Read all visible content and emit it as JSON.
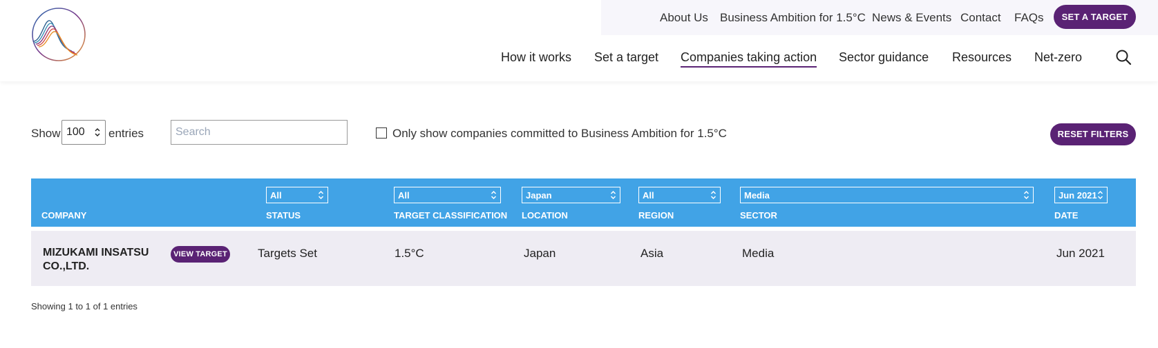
{
  "header": {
    "util_nav": [
      "About Us",
      "Business Ambition for 1.5°C",
      "News & Events",
      "Contact",
      "FAQs"
    ],
    "cta_label": "SET A TARGET",
    "main_nav": [
      "How it works",
      "Set a target",
      "Companies taking action",
      "Sector guidance",
      "Resources",
      "Net-zero"
    ],
    "active_nav": "Companies taking action"
  },
  "controls": {
    "show_label": "Show",
    "entries_value": "100",
    "entries_label": "entries",
    "search_placeholder": "Search",
    "checkbox_label": "Only show companies committed to Business Ambition for 1.5°C",
    "reset_label": "RESET FILTERS"
  },
  "table": {
    "columns": [
      "COMPANY",
      "STATUS",
      "TARGET CLASSIFICATION",
      "LOCATION",
      "REGION",
      "SECTOR",
      "DATE"
    ],
    "filters": {
      "status": "All",
      "target_classification": "All",
      "location": "Japan",
      "region": "All",
      "sector": "Media",
      "date": "Jun 2021"
    },
    "rows": [
      {
        "company": "MIZUKAMI INSATSU CO.,LTD.",
        "action_label": "VIEW TARGET",
        "status": "Targets Set",
        "classification": "1.5°C",
        "location": "Japan",
        "region": "Asia",
        "sector": "Media",
        "date": "Jun 2021"
      }
    ]
  },
  "footer": {
    "info": "Showing 1 to 1 of 1 entries"
  },
  "colors": {
    "brand_purple": "#5a2274",
    "table_header_blue": "#41a3e6",
    "row_background": "#eeecf3"
  }
}
